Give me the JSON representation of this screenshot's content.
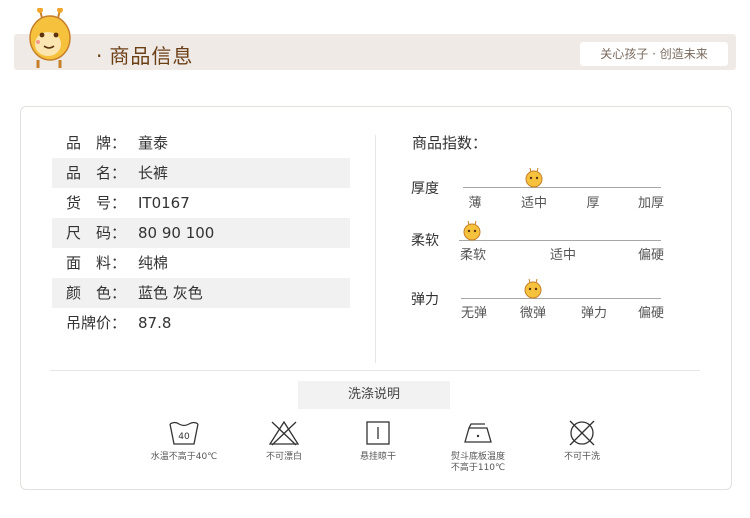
{
  "header": {
    "title": "商品信息",
    "slogan": "关心孩子 · 创造未来"
  },
  "product": [
    {
      "label": "品　牌：",
      "value": "童泰"
    },
    {
      "label": "品　名：",
      "value": "长裤"
    },
    {
      "label": "货　号：",
      "value": "IT0167"
    },
    {
      "label": "尺　码：",
      "value": "80 90 100"
    },
    {
      "label": "面　料：",
      "value": "纯棉"
    },
    {
      "label": "颜　色：",
      "value": "蓝色 灰色"
    },
    {
      "label": "吊牌价：",
      "value": "87.8"
    }
  ],
  "index": {
    "title": "商品指数：",
    "scales": [
      {
        "name": "厚度",
        "options": [
          "薄",
          "适中",
          "厚",
          "加厚"
        ],
        "selected": 1
      },
      {
        "name": "柔软",
        "options": [
          "柔软",
          "适中",
          "偏硬"
        ],
        "selected": 0
      },
      {
        "name": "弹力",
        "options": [
          "无弹",
          "微弹",
          "弹力",
          "偏硬"
        ],
        "selected": 1
      }
    ]
  },
  "washing": {
    "title": "洗涤说明",
    "items": [
      {
        "icon": "wash-40-icon",
        "label": "水温不高于40℃",
        "badge": "40"
      },
      {
        "icon": "no-bleach-icon",
        "label": "不可漂白"
      },
      {
        "icon": "hang-dry-icon",
        "label": "悬挂晾干"
      },
      {
        "icon": "iron-110-icon",
        "label": "熨斗底板温度\n不高于110℃"
      },
      {
        "icon": "no-dry-clean-icon",
        "label": "不可干洗"
      }
    ]
  },
  "colors": {
    "header_bg": "#efeae6",
    "title_brown": "#6b3f16",
    "mascot_orange": "#f0a62a"
  }
}
